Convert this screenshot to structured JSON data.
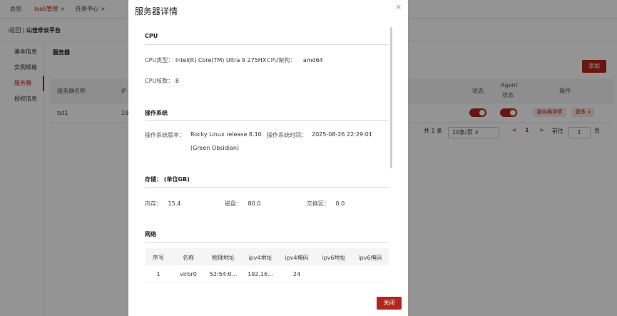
{
  "tabs": [
    {
      "label": "总览",
      "close": ""
    },
    {
      "label": "IaaS管理",
      "close": "×"
    },
    {
      "label": "任务中心",
      "close": "×"
    }
  ],
  "header": {
    "back": "返回",
    "sep": "|",
    "title": "山佳非云平台"
  },
  "sidebar": {
    "items": [
      {
        "label": "基本信息"
      },
      {
        "label": "实例规格"
      },
      {
        "label": "服务器"
      },
      {
        "label": "授权信息"
      }
    ]
  },
  "main": {
    "section_title": "服务器",
    "add_label": "添加",
    "columns": {
      "name": "服务器名称",
      "ip": "IP",
      "status": "状态",
      "agent_line1": "Agent",
      "agent_line2": "状态",
      "ops": "操作"
    },
    "row": {
      "name": "tst1",
      "ip": "19",
      "detail_btn": "服务器详情",
      "more_btn": "更多 ∨"
    },
    "pager": {
      "total": "共 1 条",
      "size": "10条/页 ∨",
      "prev": "<",
      "page": "1",
      "next": ">",
      "goto": "前往",
      "goto_val": "1",
      "page_unit": "页"
    }
  },
  "modal": {
    "title": "服务器详情",
    "close_icon": "×",
    "cpu": {
      "title": "CPU",
      "type_label": "CPU类型：",
      "type_value": "Intel(R) Core(TM) Ultra 9 275HX",
      "arch_label": "CPU架构：",
      "arch_value": "amd64",
      "cores_label": "CPU核数：",
      "cores_value": "8"
    },
    "os": {
      "title": "操作系统",
      "version_label": "操作系统版本：",
      "version_line1": "Rocky Linux release 8.10",
      "version_line2": "(Green Obsidian)",
      "time_label": "操作系统时间：",
      "time_value": "2025-08-26 22:29:01"
    },
    "storage": {
      "title": "存储：  (单位GB)",
      "mem_label": "内存：",
      "mem_value": "15.4",
      "disk_label": "磁盘：",
      "disk_value": "80.0",
      "swap_label": "交换区：",
      "swap_value": "0.0"
    },
    "network": {
      "title": "网络",
      "columns": [
        "序号",
        "名称",
        "物理地址",
        "ipv4地址",
        "ipv4掩码",
        "ipv6地址",
        "ipv6掩码"
      ],
      "rows": [
        [
          "1",
          "virbr0",
          "52:54:0...",
          "192.16...",
          "24",
          "",
          ""
        ]
      ]
    },
    "close_label": "关闭"
  }
}
